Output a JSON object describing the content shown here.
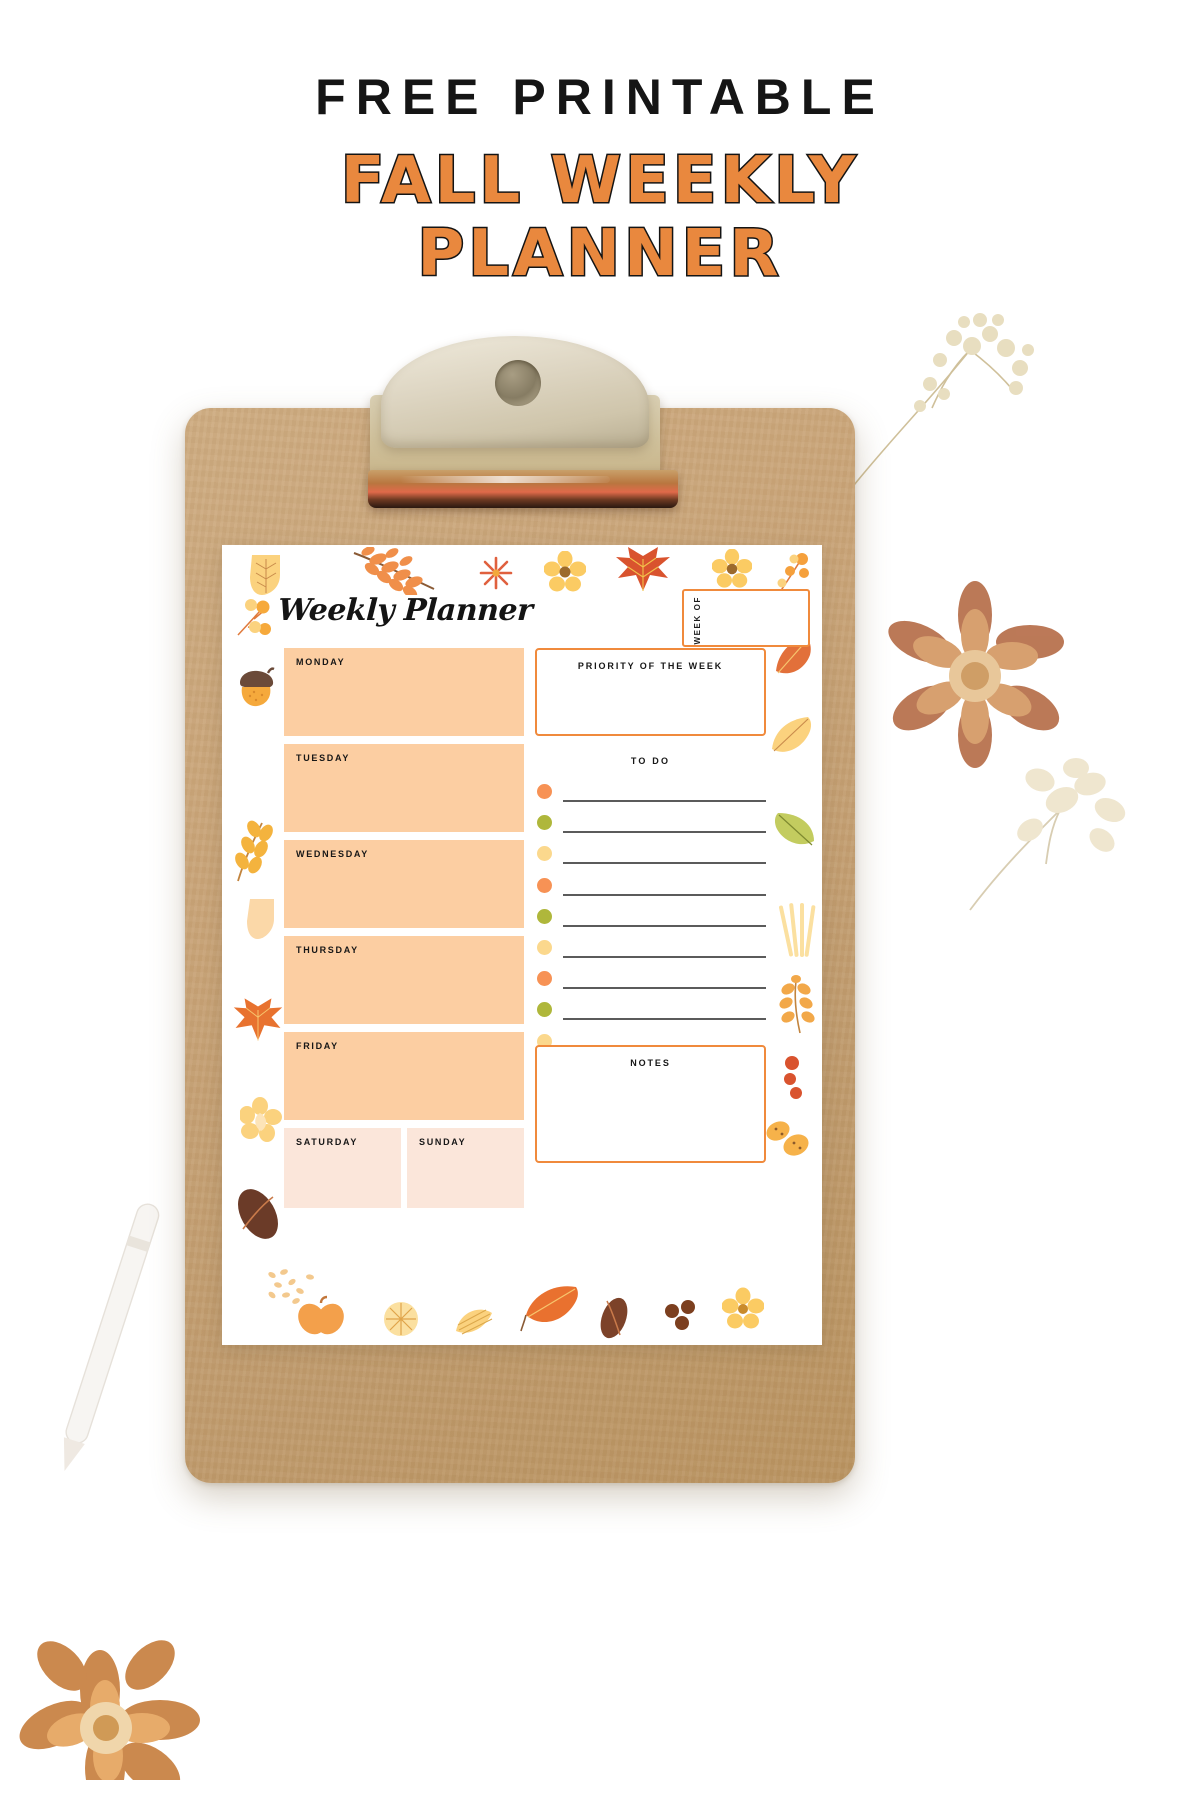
{
  "headline": {
    "line1": "FREE PRINTABLE",
    "line2": "FALL WEEKLY",
    "line3": "PLANNER",
    "accent_color": "#E9883E",
    "outline_color": "#141414"
  },
  "planner": {
    "title": "Weekly Planner",
    "week_of_label": "WEEK OF",
    "week_of_value": "",
    "priority": {
      "caption": "PRIORITY OF THE WEEK",
      "value": ""
    },
    "todo": {
      "caption": "TO DO",
      "dot_colors": [
        "#F79255",
        "#AFB73B",
        "#FBD88D"
      ],
      "items": [
        "",
        "",
        "",
        "",
        "",
        "",
        "",
        "",
        "",
        "",
        "",
        ""
      ]
    },
    "notes": {
      "caption": "NOTES",
      "value": ""
    },
    "days": [
      {
        "label": "MONDAY",
        "value": "",
        "type": "weekday",
        "fill": "#FCCEA2"
      },
      {
        "label": "TUESDAY",
        "value": "",
        "type": "weekday",
        "fill": "#FCCEA2"
      },
      {
        "label": "WEDNESDAY",
        "value": "",
        "type": "weekday",
        "fill": "#FCCEA2"
      },
      {
        "label": "THURSDAY",
        "value": "",
        "type": "weekday",
        "fill": "#FCCEA2"
      },
      {
        "label": "FRIDAY",
        "value": "",
        "type": "weekday",
        "fill": "#FCCEA2"
      },
      {
        "label": "SATURDAY",
        "value": "",
        "type": "weekend",
        "fill": "#FBE6DA"
      },
      {
        "label": "SUNDAY",
        "value": "",
        "type": "weekend",
        "fill": "#FBE6DA"
      }
    ]
  },
  "scene": {
    "board_color": "#C8A377",
    "clip_color": "#DED6C3",
    "background": "#FFFFFF",
    "props": [
      "dried-flower-icon",
      "dried-flower-icon",
      "dried-sprig-icon",
      "pen-icon",
      "dried-flower-icon"
    ]
  },
  "decorations": {
    "icons": [
      "leaf-icon",
      "branch-leaves-icon",
      "star-flower-icon",
      "flower-icon",
      "maple-leaf-icon",
      "berry-sprig-icon",
      "acorn-icon",
      "yellow-leaf-icon",
      "wheat-sprig-icon",
      "leaf-icon",
      "maple-leaf-icon",
      "green-leaf-icon",
      "seeds-icon",
      "flower-icon",
      "cocoa-pod-icon",
      "pumpkin-icon",
      "ginkgo-leaf-icon",
      "leaf-icon",
      "berries-icon",
      "flower-icon",
      "butterfly-icon",
      "fern-leaf-icon",
      "acorn-icon"
    ]
  }
}
